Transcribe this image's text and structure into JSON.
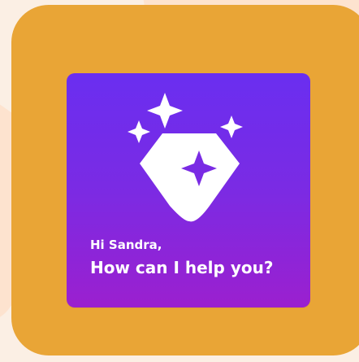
{
  "assistant_card": {
    "greeting": "Hi Sandra,",
    "prompt": "How can I help you?"
  },
  "icons": {
    "hero_icon": "diamond-sparkles-icon"
  },
  "colors": {
    "background": "#fbefe4",
    "background_shapes": "#fde3cf",
    "orange_panel": "#e9a536",
    "card_gradient_top": "#6a2ef0",
    "card_gradient_bottom": "#9b20cf",
    "foreground": "#ffffff"
  }
}
